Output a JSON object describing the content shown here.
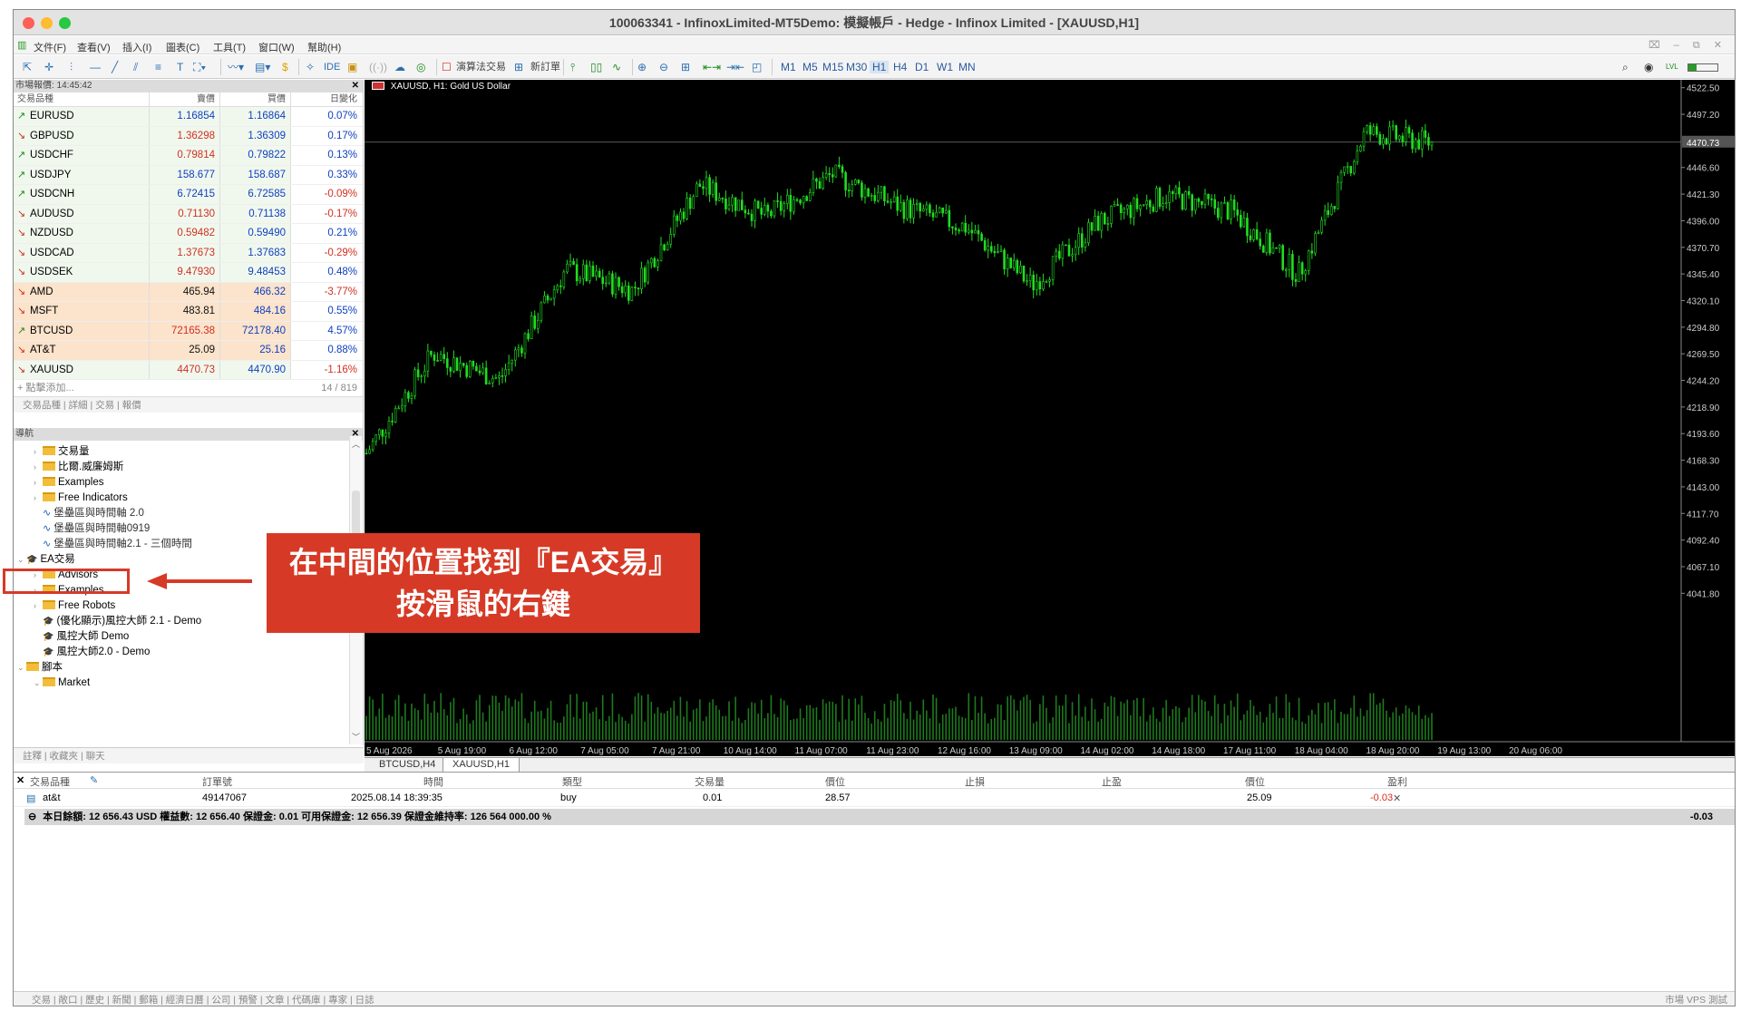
{
  "window": {
    "title": "100063341 - InfinoxLimited-MT5Demo: 模擬帳戶 - Hedge - Infinox Limited - [XAUUSD,H1]",
    "controls": "⌧ – ⧉ ✕"
  },
  "menu": [
    "文件(F)",
    "查看(V)",
    "插入(I)",
    "圖表(C)",
    "工具(T)",
    "窗口(W)",
    "幫助(H)"
  ],
  "toolbar": {
    "ide": "IDE",
    "algo": "演算法交易",
    "new_order": "新訂單",
    "timeframes": [
      "M1",
      "M5",
      "M15",
      "M30",
      "H1",
      "H4",
      "D1",
      "W1",
      "MN"
    ],
    "active_tf": "H1",
    "lvl": "LVL"
  },
  "market_watch": {
    "title": "市場報價: 14:45:42",
    "headers": [
      "交易品種",
      "賣價",
      "買價",
      "日變化"
    ],
    "rows": [
      {
        "sym": "EURUSD",
        "bid": "1.16854",
        "ask": "1.16864",
        "chg": "0.07%",
        "dir": "up",
        "bidc": "bidb",
        "chgc": "chgb",
        "bg": "bgg"
      },
      {
        "sym": "GBPUSD",
        "bid": "1.36298",
        "ask": "1.36309",
        "chg": "0.17%",
        "dir": "dn",
        "bidc": "bidr",
        "chgc": "chgb",
        "bg": "bgg"
      },
      {
        "sym": "USDCHF",
        "bid": "0.79814",
        "ask": "0.79822",
        "chg": "0.13%",
        "dir": "up",
        "bidc": "bidr",
        "chgc": "chgb",
        "bg": "bgg"
      },
      {
        "sym": "USDJPY",
        "bid": "158.677",
        "ask": "158.687",
        "chg": "0.33%",
        "dir": "up",
        "bidc": "bidb",
        "chgc": "chgb",
        "bg": "bgg"
      },
      {
        "sym": "USDCNH",
        "bid": "6.72415",
        "ask": "6.72585",
        "chg": "-0.09%",
        "dir": "up",
        "bidc": "bidb",
        "chgc": "chgr",
        "bg": "bgg"
      },
      {
        "sym": "AUDUSD",
        "bid": "0.71130",
        "ask": "0.71138",
        "chg": "-0.17%",
        "dir": "dn",
        "bidc": "bidr",
        "chgc": "chgr",
        "bg": "bgg"
      },
      {
        "sym": "NZDUSD",
        "bid": "0.59482",
        "ask": "0.59490",
        "chg": "0.21%",
        "dir": "dn",
        "bidc": "bidr",
        "chgc": "chgb",
        "bg": "bgg"
      },
      {
        "sym": "USDCAD",
        "bid": "1.37673",
        "ask": "1.37683",
        "chg": "-0.29%",
        "dir": "dn",
        "bidc": "bidr",
        "chgc": "chgr",
        "bg": "bgg"
      },
      {
        "sym": "USDSEK",
        "bid": "9.47930",
        "ask": "9.48453",
        "chg": "0.48%",
        "dir": "dn",
        "bidc": "bidr",
        "chgc": "chgb",
        "bg": "bgg"
      },
      {
        "sym": "AMD",
        "bid": "465.94",
        "ask": "466.32",
        "chg": "-3.77%",
        "dir": "dn",
        "bidc": "bidk",
        "chgc": "chgr",
        "bg": "bgo"
      },
      {
        "sym": "MSFT",
        "bid": "483.81",
        "ask": "484.16",
        "chg": "0.55%",
        "dir": "dn",
        "bidc": "bidk",
        "chgc": "chgb",
        "bg": "bgo"
      },
      {
        "sym": "BTCUSD",
        "bid": "72165.38",
        "ask": "72178.40",
        "chg": "4.57%",
        "dir": "up",
        "bidc": "bidr",
        "chgc": "chgb",
        "bg": "bgo"
      },
      {
        "sym": "AT&T",
        "bid": "25.09",
        "ask": "25.16",
        "chg": "0.88%",
        "dir": "dn",
        "bidc": "bidk",
        "chgc": "chgb",
        "bg": "bgo"
      },
      {
        "sym": "XAUUSD",
        "bid": "4470.73",
        "ask": "4470.90",
        "chg": "-1.16%",
        "dir": "dn",
        "bidc": "bidr",
        "chgc": "chgr",
        "bg": "bgg"
      }
    ],
    "add_label": "+ 點擊添加...",
    "count": "14 / 819",
    "tabs": "交易品種 | 詳細 | 交易 | 報價"
  },
  "navigator": {
    "title": "導航",
    "items": [
      {
        "label": "交易量",
        "kind": "folder",
        "lvl": 2
      },
      {
        "label": "比爾.威廉姆斯",
        "kind": "folder",
        "lvl": 2
      },
      {
        "label": "Examples",
        "kind": "folder",
        "lvl": 2
      },
      {
        "label": "Free Indicators",
        "kind": "folder",
        "lvl": 2
      },
      {
        "label": "堡壘區與時間軸 2.0",
        "kind": "indicator",
        "lvl": 2
      },
      {
        "label": "堡壘區與時間軸0919",
        "kind": "indicator",
        "lvl": 2
      },
      {
        "label": "堡壘區與時間軸2.1 - 三個時間",
        "kind": "indicator",
        "lvl": 2
      },
      {
        "label": "EA交易",
        "kind": "ea-root",
        "lvl": 1
      },
      {
        "label": "Advisors",
        "kind": "folder",
        "lvl": 2
      },
      {
        "label": "Examples",
        "kind": "folder",
        "lvl": 2
      },
      {
        "label": "Free Robots",
        "kind": "folder",
        "lvl": 2
      },
      {
        "label": "(優化顯示)風控大師 2.1 - Demo",
        "kind": "ea",
        "lvl": 2
      },
      {
        "label": "風控大師 Demo",
        "kind": "ea",
        "lvl": 2
      },
      {
        "label": "風控大師2.0 - Demo",
        "kind": "ea",
        "lvl": 2
      },
      {
        "label": "腳本",
        "kind": "script-root",
        "lvl": 1
      },
      {
        "label": "Market",
        "kind": "folder-open",
        "lvl": 2
      }
    ],
    "tabs": "註釋 | 收藏夾 | 聊天"
  },
  "callout": {
    "line1": "在中間的位置找到『EA交易』",
    "line2": "按滑鼠的右鍵"
  },
  "chart": {
    "label": "XAUUSD, H1:  Gold US Dollar",
    "price_ticks": [
      "4522.50",
      "4497.20",
      "4446.60",
      "4421.30",
      "4396.00",
      "4370.70",
      "4345.40",
      "4320.10",
      "4294.80",
      "4269.50",
      "4244.20",
      "4218.90",
      "4193.60",
      "4168.30",
      "4143.00",
      "4117.70",
      "4092.40",
      "4067.10",
      "4041.80"
    ],
    "current_price": "4470.73",
    "time_ticks": [
      "5 Aug 2026",
      "5 Aug 19:00",
      "6 Aug 12:00",
      "7 Aug 05:00",
      "7 Aug 21:00",
      "10 Aug 14:00",
      "11 Aug 07:00",
      "11 Aug 23:00",
      "12 Aug 16:00",
      "13 Aug 09:00",
      "14 Aug 02:00",
      "14 Aug 18:00",
      "17 Aug 11:00",
      "18 Aug 04:00",
      "18 Aug 20:00",
      "19 Aug 13:00",
      "20 Aug 06:00"
    ],
    "tabs": [
      "BTCUSD,H4",
      "XAUUSD,H1"
    ],
    "active_tab": "XAUUSD,H1",
    "candle_color": "#22dd22",
    "volume_color": "#1e7a1e"
  },
  "chart_data": {
    "type": "line",
    "title": "XAUUSD, H1:  Gold US Dollar",
    "xlabel": "",
    "ylabel": "",
    "ylim": [
      4030,
      4530
    ],
    "x": [
      "5 Aug 2026",
      "5 Aug 19:00",
      "6 Aug 12:00",
      "7 Aug 05:00",
      "7 Aug 21:00",
      "10 Aug 14:00",
      "11 Aug 07:00",
      "11 Aug 23:00",
      "12 Aug 16:00",
      "13 Aug 09:00",
      "14 Aug 02:00",
      "14 Aug 18:00",
      "17 Aug 11:00",
      "18 Aug 04:00",
      "18 Aug 20:00",
      "19 Aug 13:00",
      "20 Aug 06:00"
    ],
    "series": [
      {
        "values": [
          4175,
          4270,
          4245,
          4350,
          4330,
          4430,
          4400,
          4440,
          4410,
          4390,
          4335,
          4395,
          4420,
          4405,
          4345,
          4480,
          4470
        ]
      }
    ]
  },
  "toolbox": {
    "headers": [
      "交易品種",
      "訂單號",
      "時間",
      "類型",
      "交易量",
      "價位",
      "止損",
      "止盈",
      "價位",
      "盈利"
    ],
    "row": {
      "sym": "at&t",
      "order": "49147067",
      "time": "2025.08.14 18:39:35",
      "type": "buy",
      "vol": "0.01",
      "price": "28.57",
      "sl": "",
      "tp": "",
      "cur": "25.09",
      "profit": "-0.03"
    },
    "balance": "本日餘額: 12 656.43 USD  權益數: 12 656.40  保證金: 0.01  可用保證金: 12 656.39  保證金維持率: 126 564 000.00 %",
    "total": "-0.03",
    "tabs": "交易 | 敞口 | 歷史 | 新聞 | 郵箱 | 經濟日曆 | 公司 | 預警 | 文章 | 代碼庫 | 專家 | 日誌",
    "status_right": "市場    VPS    測試"
  }
}
